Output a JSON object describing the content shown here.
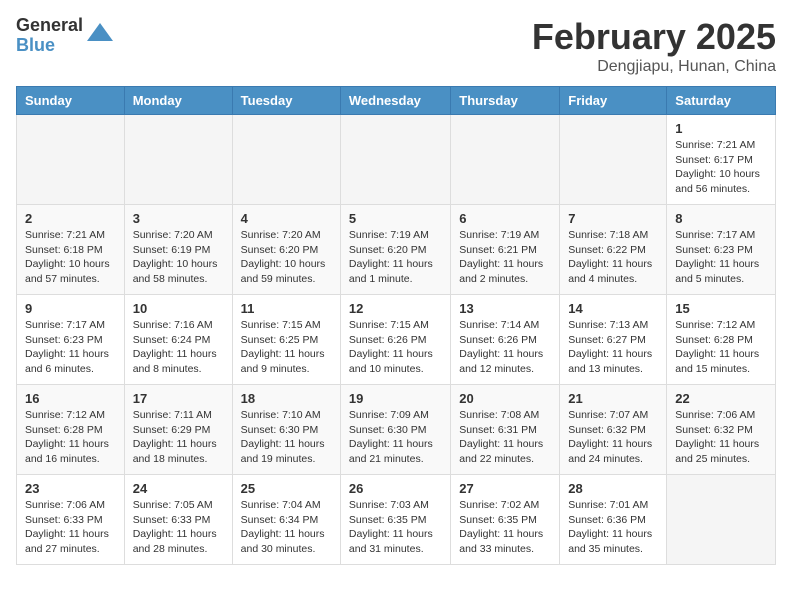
{
  "logo": {
    "general": "General",
    "blue": "Blue"
  },
  "title": "February 2025",
  "location": "Dengjiapu, Hunan, China",
  "days_of_week": [
    "Sunday",
    "Monday",
    "Tuesday",
    "Wednesday",
    "Thursday",
    "Friday",
    "Saturday"
  ],
  "weeks": [
    [
      {
        "day": "",
        "info": ""
      },
      {
        "day": "",
        "info": ""
      },
      {
        "day": "",
        "info": ""
      },
      {
        "day": "",
        "info": ""
      },
      {
        "day": "",
        "info": ""
      },
      {
        "day": "",
        "info": ""
      },
      {
        "day": "1",
        "info": "Sunrise: 7:21 AM\nSunset: 6:17 PM\nDaylight: 10 hours and 56 minutes."
      }
    ],
    [
      {
        "day": "2",
        "info": "Sunrise: 7:21 AM\nSunset: 6:18 PM\nDaylight: 10 hours and 57 minutes."
      },
      {
        "day": "3",
        "info": "Sunrise: 7:20 AM\nSunset: 6:19 PM\nDaylight: 10 hours and 58 minutes."
      },
      {
        "day": "4",
        "info": "Sunrise: 7:20 AM\nSunset: 6:20 PM\nDaylight: 10 hours and 59 minutes."
      },
      {
        "day": "5",
        "info": "Sunrise: 7:19 AM\nSunset: 6:20 PM\nDaylight: 11 hours and 1 minute."
      },
      {
        "day": "6",
        "info": "Sunrise: 7:19 AM\nSunset: 6:21 PM\nDaylight: 11 hours and 2 minutes."
      },
      {
        "day": "7",
        "info": "Sunrise: 7:18 AM\nSunset: 6:22 PM\nDaylight: 11 hours and 4 minutes."
      },
      {
        "day": "8",
        "info": "Sunrise: 7:17 AM\nSunset: 6:23 PM\nDaylight: 11 hours and 5 minutes."
      }
    ],
    [
      {
        "day": "9",
        "info": "Sunrise: 7:17 AM\nSunset: 6:23 PM\nDaylight: 11 hours and 6 minutes."
      },
      {
        "day": "10",
        "info": "Sunrise: 7:16 AM\nSunset: 6:24 PM\nDaylight: 11 hours and 8 minutes."
      },
      {
        "day": "11",
        "info": "Sunrise: 7:15 AM\nSunset: 6:25 PM\nDaylight: 11 hours and 9 minutes."
      },
      {
        "day": "12",
        "info": "Sunrise: 7:15 AM\nSunset: 6:26 PM\nDaylight: 11 hours and 10 minutes."
      },
      {
        "day": "13",
        "info": "Sunrise: 7:14 AM\nSunset: 6:26 PM\nDaylight: 11 hours and 12 minutes."
      },
      {
        "day": "14",
        "info": "Sunrise: 7:13 AM\nSunset: 6:27 PM\nDaylight: 11 hours and 13 minutes."
      },
      {
        "day": "15",
        "info": "Sunrise: 7:12 AM\nSunset: 6:28 PM\nDaylight: 11 hours and 15 minutes."
      }
    ],
    [
      {
        "day": "16",
        "info": "Sunrise: 7:12 AM\nSunset: 6:28 PM\nDaylight: 11 hours and 16 minutes."
      },
      {
        "day": "17",
        "info": "Sunrise: 7:11 AM\nSunset: 6:29 PM\nDaylight: 11 hours and 18 minutes."
      },
      {
        "day": "18",
        "info": "Sunrise: 7:10 AM\nSunset: 6:30 PM\nDaylight: 11 hours and 19 minutes."
      },
      {
        "day": "19",
        "info": "Sunrise: 7:09 AM\nSunset: 6:30 PM\nDaylight: 11 hours and 21 minutes."
      },
      {
        "day": "20",
        "info": "Sunrise: 7:08 AM\nSunset: 6:31 PM\nDaylight: 11 hours and 22 minutes."
      },
      {
        "day": "21",
        "info": "Sunrise: 7:07 AM\nSunset: 6:32 PM\nDaylight: 11 hours and 24 minutes."
      },
      {
        "day": "22",
        "info": "Sunrise: 7:06 AM\nSunset: 6:32 PM\nDaylight: 11 hours and 25 minutes."
      }
    ],
    [
      {
        "day": "23",
        "info": "Sunrise: 7:06 AM\nSunset: 6:33 PM\nDaylight: 11 hours and 27 minutes."
      },
      {
        "day": "24",
        "info": "Sunrise: 7:05 AM\nSunset: 6:33 PM\nDaylight: 11 hours and 28 minutes."
      },
      {
        "day": "25",
        "info": "Sunrise: 7:04 AM\nSunset: 6:34 PM\nDaylight: 11 hours and 30 minutes."
      },
      {
        "day": "26",
        "info": "Sunrise: 7:03 AM\nSunset: 6:35 PM\nDaylight: 11 hours and 31 minutes."
      },
      {
        "day": "27",
        "info": "Sunrise: 7:02 AM\nSunset: 6:35 PM\nDaylight: 11 hours and 33 minutes."
      },
      {
        "day": "28",
        "info": "Sunrise: 7:01 AM\nSunset: 6:36 PM\nDaylight: 11 hours and 35 minutes."
      },
      {
        "day": "",
        "info": ""
      }
    ]
  ]
}
